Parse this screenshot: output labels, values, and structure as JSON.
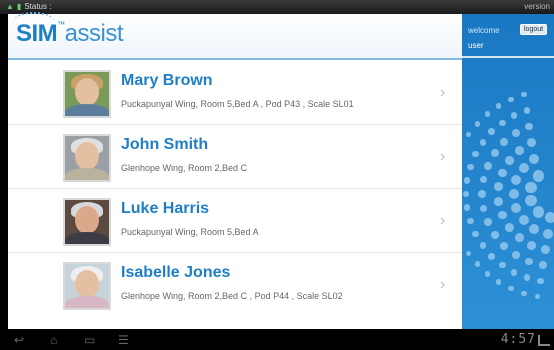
{
  "status_bar": {
    "left_label": "Status :",
    "right_label": "version"
  },
  "header": {
    "logo_main": "SIM",
    "logo_tm": "™",
    "logo_sub": "assist"
  },
  "sidebar": {
    "welcome": "welcome",
    "user": "user",
    "logout_label": "logout"
  },
  "patients": [
    {
      "name": "Mary Brown",
      "location": "Puckapunyal Wing, Room 5,Bed A , Pod P43 , Scale SL01"
    },
    {
      "name": "John Smith",
      "location": "Glenhope Wing, Room 2,Bed C"
    },
    {
      "name": "Luke Harris",
      "location": "Puckapunyal Wing, Room 5,Bed A"
    },
    {
      "name": "Isabelle Jones",
      "location": "Glenhope Wing, Room 2,Bed C , Pod P44 , Scale SL02"
    }
  ],
  "navbar": {
    "time": "4:57"
  },
  "colors": {
    "brand_blue": "#1f7fc4",
    "sidebar_blue": "#1a78c2"
  }
}
